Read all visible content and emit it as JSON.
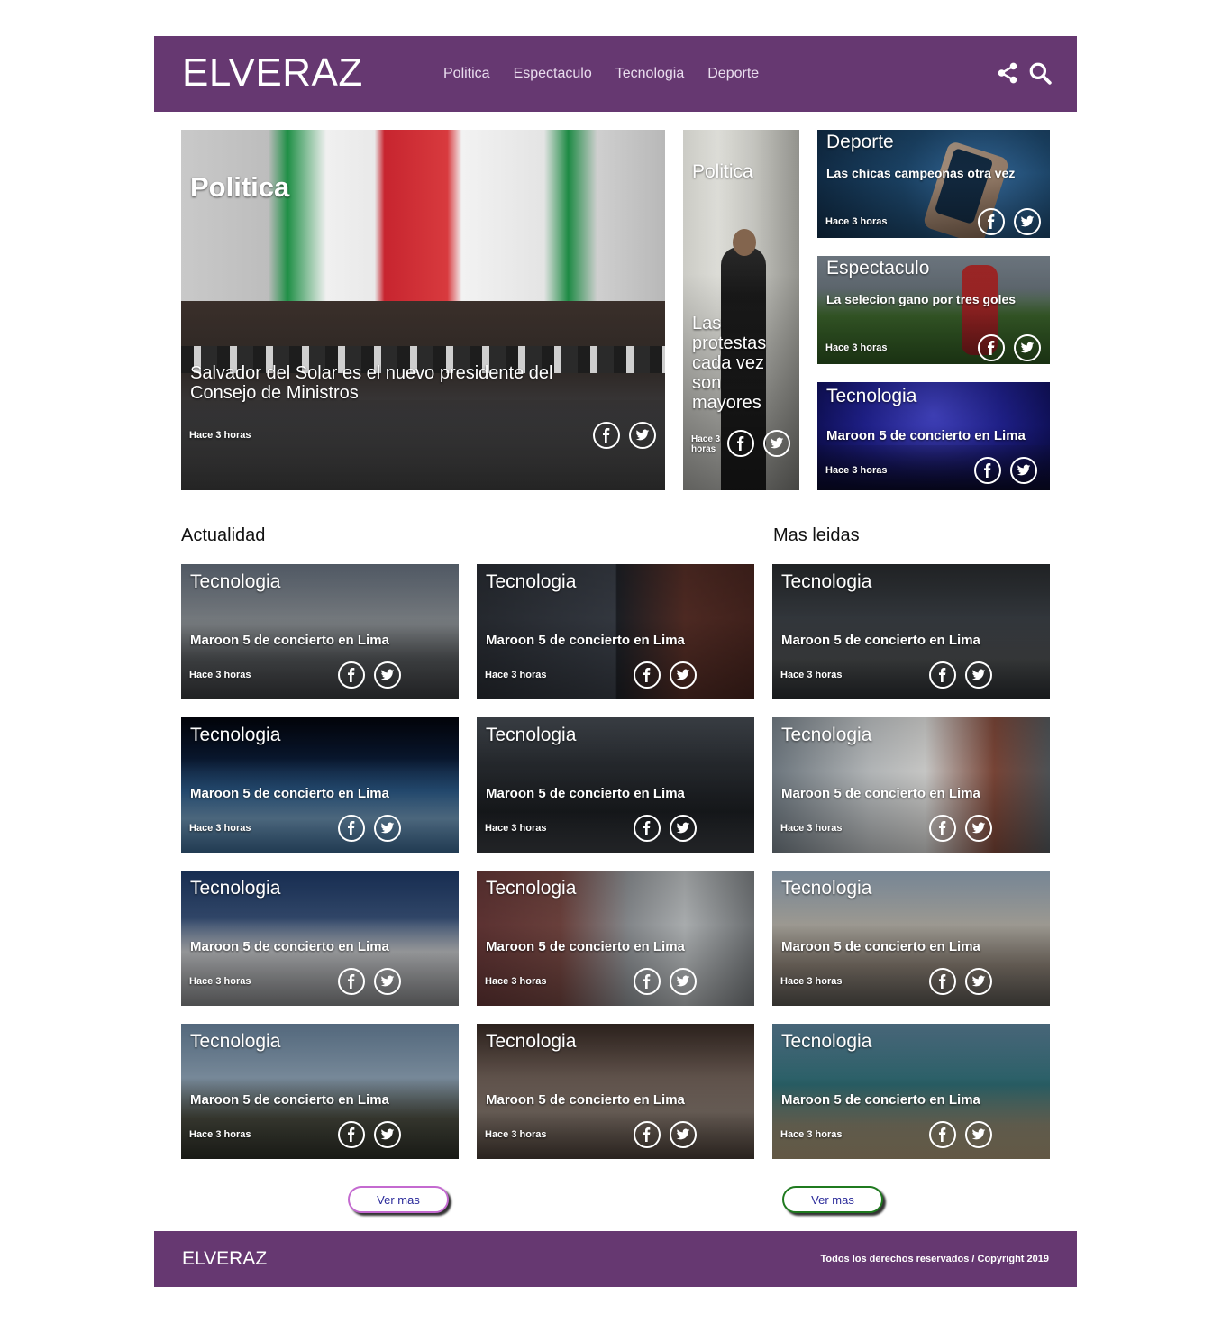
{
  "header": {
    "logo": "ELVERAZ",
    "nav": [
      "Politica",
      "Espectaculo",
      "Tecnologia",
      "Deporte"
    ],
    "icons": [
      "share-icon",
      "search-icon"
    ]
  },
  "hero": {
    "main": {
      "category": "Politica",
      "title": "Salvador del Solar es el nuevo presidente del Consejo de Ministros",
      "time": "Hace 3 horas"
    },
    "side": {
      "category": "Politica",
      "title": "Las protestas cada vez son mayores",
      "time": "Hace 3 horas"
    },
    "small": [
      {
        "category": "Deporte",
        "title": "Las chicas campeonas otra vez",
        "time": "Hace 3 horas"
      },
      {
        "category": "Espectaculo",
        "title": "La selecion gano por tres goles",
        "time": "Hace 3 horas"
      },
      {
        "category": "Tecnologia",
        "title": "Maroon 5 de concierto en Lima",
        "time": "Hace 3 horas"
      }
    ]
  },
  "sections": {
    "actualidad": "Actualidad",
    "mas_leidas": "Mas leidas"
  },
  "grid_card": {
    "category": "Tecnologia",
    "title": "Maroon 5 de concierto en Lima",
    "time": "Hace 3 horas"
  },
  "buttons": {
    "ver_mas_left": "Ver mas",
    "ver_mas_right": "Ver mas"
  },
  "footer": {
    "logo": "ELVERAZ",
    "copyright": "Todos los derechos reservados / Copyright 2019"
  },
  "colors": {
    "brand": "#663871",
    "nav_text": "#e9ddee",
    "button_left_border": "#c46ad0",
    "button_right_border": "#1f7a1f"
  }
}
